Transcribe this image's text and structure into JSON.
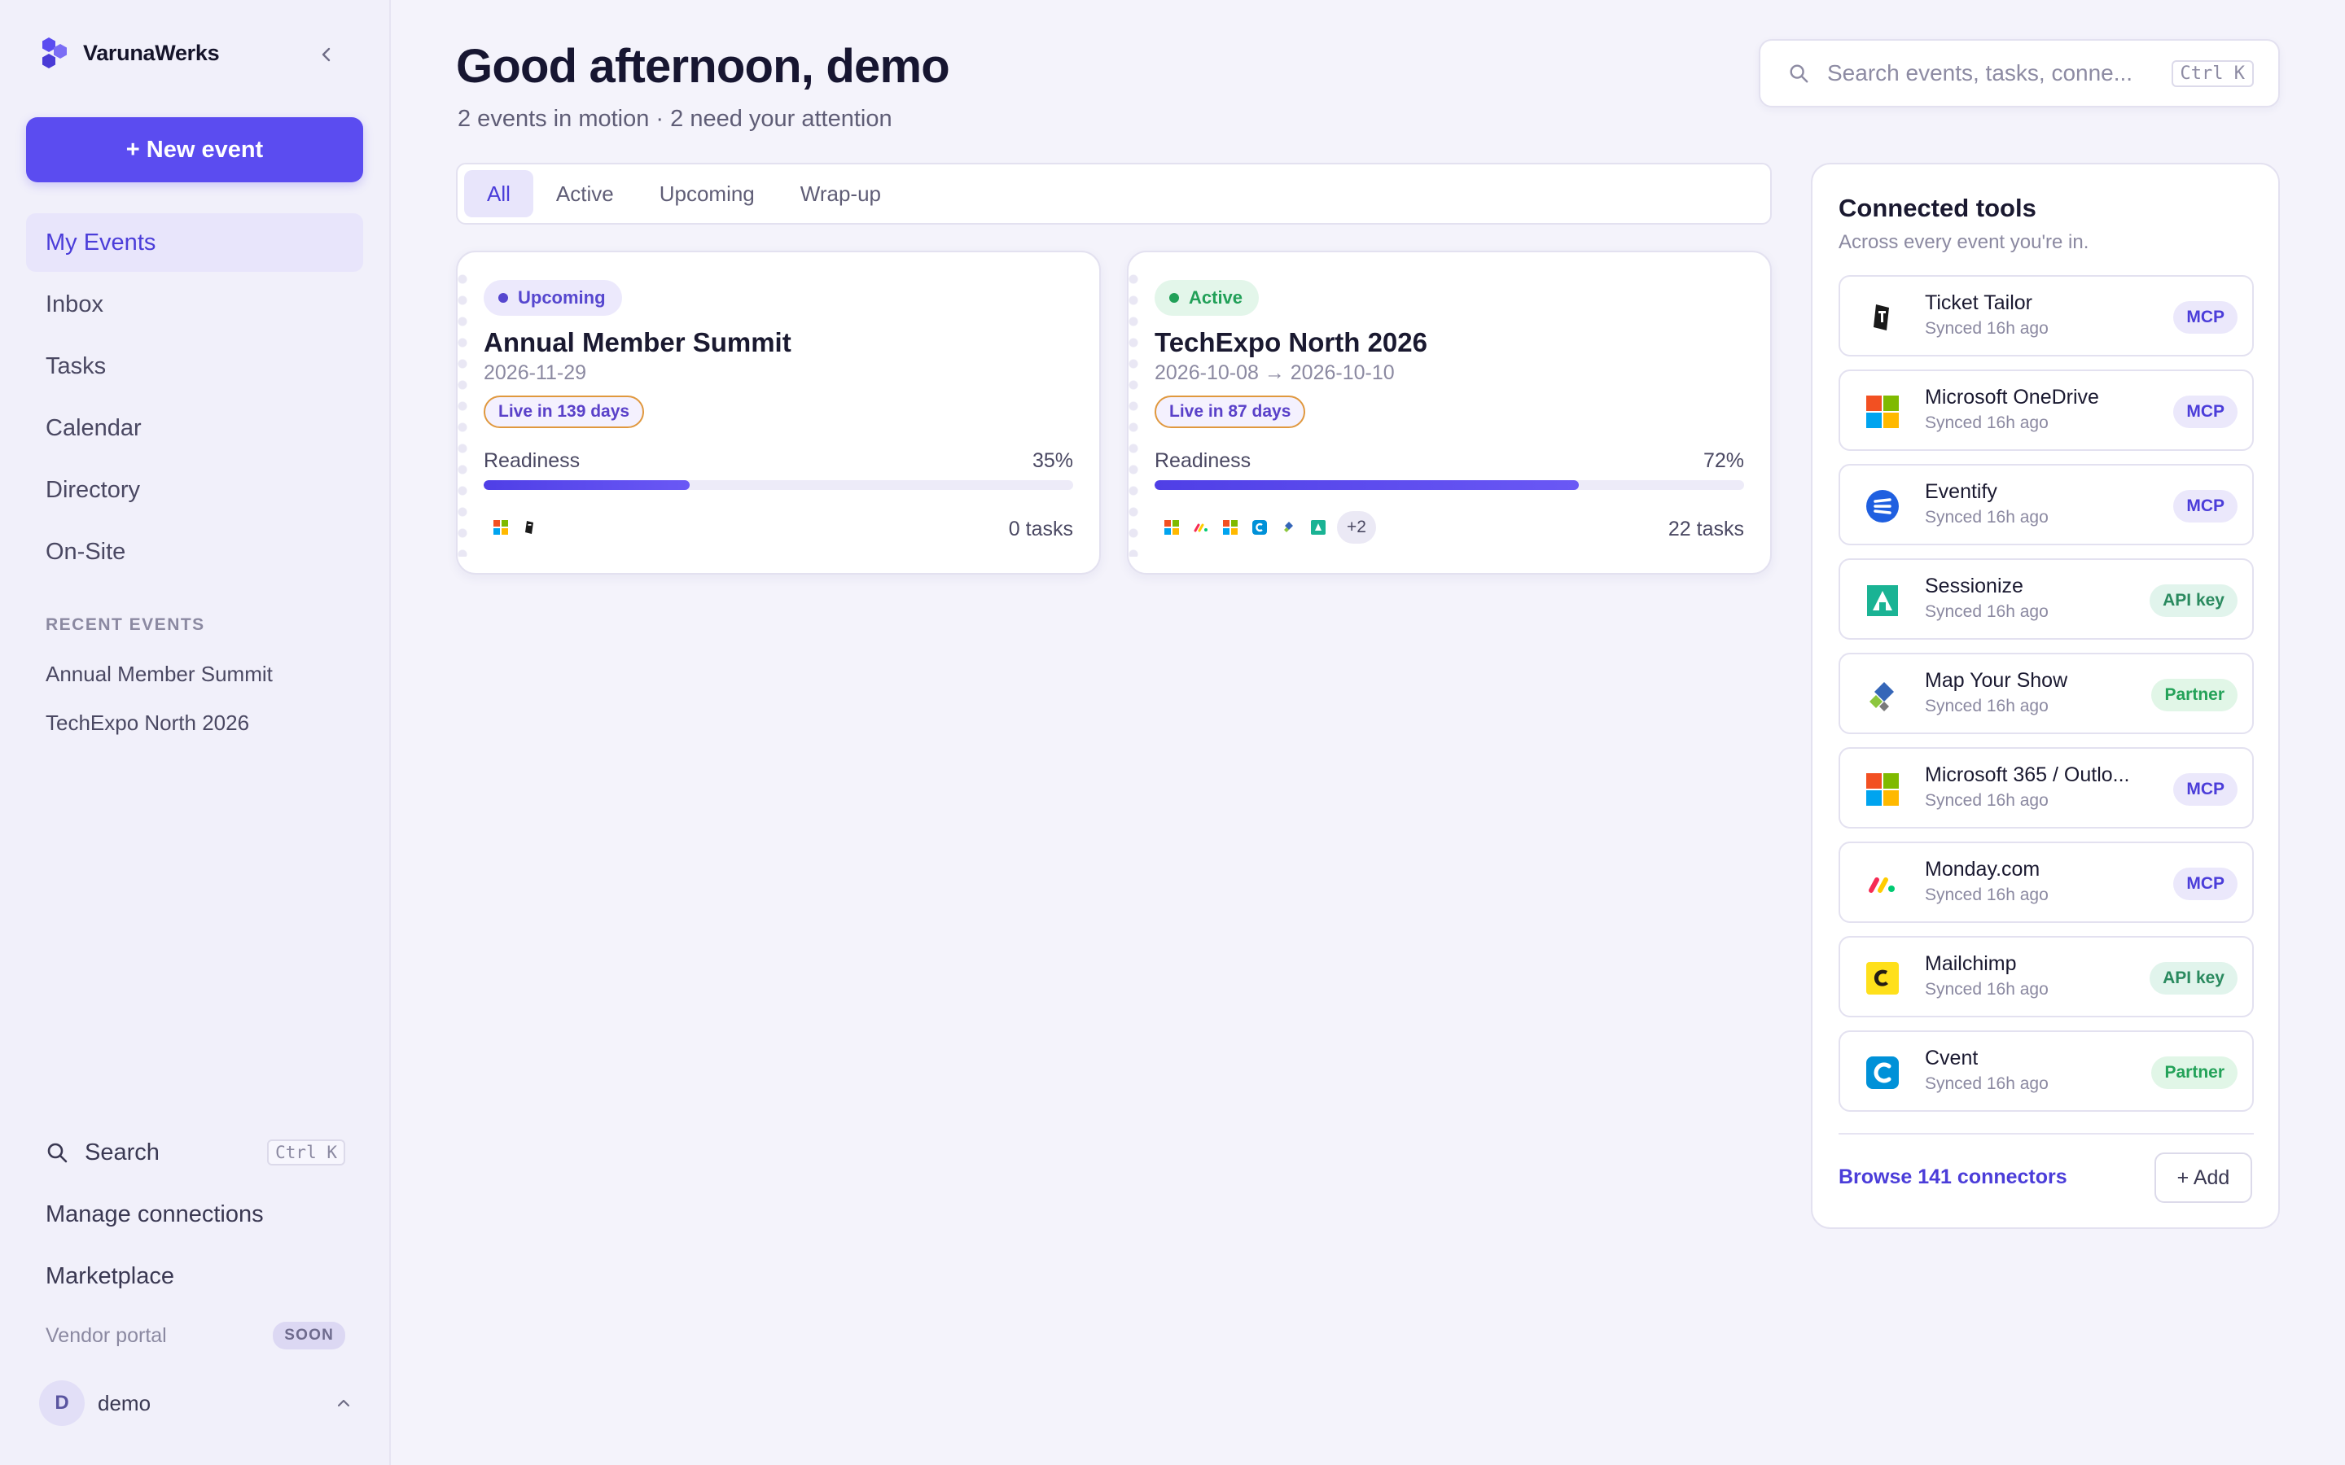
{
  "sidebar": {
    "brand": "VarunaWerks",
    "new_event_label": "+ New event",
    "nav": [
      {
        "label": "My Events",
        "active": true
      },
      {
        "label": "Inbox"
      },
      {
        "label": "Tasks"
      },
      {
        "label": "Calendar"
      },
      {
        "label": "Directory"
      },
      {
        "label": "On-Site"
      }
    ],
    "recent_title": "RECENT EVENTS",
    "recent": [
      "Annual Member Summit",
      "TechExpo North 2026"
    ],
    "search_label": "Search",
    "search_shortcut": "Ctrl K",
    "manage_connections": "Manage connections",
    "marketplace": "Marketplace",
    "vendor_portal": "Vendor portal",
    "vendor_badge": "SOON",
    "user": {
      "initial": "D",
      "name": "demo"
    }
  },
  "header": {
    "greeting": "Good afternoon, demo",
    "subtitle": "2 events in motion · 2 need your attention",
    "search_placeholder": "Search events, tasks, conne...",
    "search_shortcut": "Ctrl K"
  },
  "tabs": [
    "All",
    "Active",
    "Upcoming",
    "Wrap-up"
  ],
  "events": [
    {
      "status": "Upcoming",
      "title": "Annual Member Summit",
      "date": "2026-11-29",
      "countdown": "Live in 139 days",
      "readiness_label": "Readiness",
      "readiness_pct": "35%",
      "readiness": 0.35,
      "icons": [
        "microsoft-icon",
        "ticket-tailor-icon"
      ],
      "tasks": "0 tasks"
    },
    {
      "status": "Active",
      "title": "TechExpo North 2026",
      "date": "2026-10-08 → 2026-10-10",
      "countdown": "Live in 87 days",
      "readiness_label": "Readiness",
      "readiness_pct": "72%",
      "readiness": 0.72,
      "icons": [
        "microsoft-icon",
        "monday-icon",
        "microsoft-365-icon",
        "cvent-icon",
        "map-your-show-icon",
        "sessionize-icon"
      ],
      "more": "+2",
      "tasks": "22 tasks"
    }
  ],
  "tools": {
    "title": "Connected tools",
    "subtitle": "Across every event you're in.",
    "items": [
      {
        "name": "Ticket Tailor",
        "sync": "Synced 16h ago",
        "tag": "MCP",
        "icon": "ticket-tailor-icon"
      },
      {
        "name": "Microsoft OneDrive",
        "sync": "Synced 16h ago",
        "tag": "MCP",
        "icon": "microsoft-icon"
      },
      {
        "name": "Eventify",
        "sync": "Synced 16h ago",
        "tag": "MCP",
        "icon": "eventify-icon"
      },
      {
        "name": "Sessionize",
        "sync": "Synced 16h ago",
        "tag": "API key",
        "icon": "sessionize-icon"
      },
      {
        "name": "Map Your Show",
        "sync": "Synced 16h ago",
        "tag": "Partner",
        "icon": "map-your-show-icon"
      },
      {
        "name": "Microsoft 365 / Outlo...",
        "sync": "Synced 16h ago",
        "tag": "MCP",
        "icon": "microsoft-icon"
      },
      {
        "name": "Monday.com",
        "sync": "Synced 16h ago",
        "tag": "MCP",
        "icon": "monday-icon"
      },
      {
        "name": "Mailchimp",
        "sync": "Synced 16h ago",
        "tag": "API key",
        "icon": "mailchimp-icon"
      },
      {
        "name": "Cvent",
        "sync": "Synced 16h ago",
        "tag": "Partner",
        "icon": "cvent-icon"
      }
    ],
    "browse_label": "Browse 141 connectors",
    "add_label": "+ Add"
  },
  "colors": {
    "accent": "#5b4cf0",
    "active_green": "#21a058",
    "countdown_border": "#e0983e"
  }
}
